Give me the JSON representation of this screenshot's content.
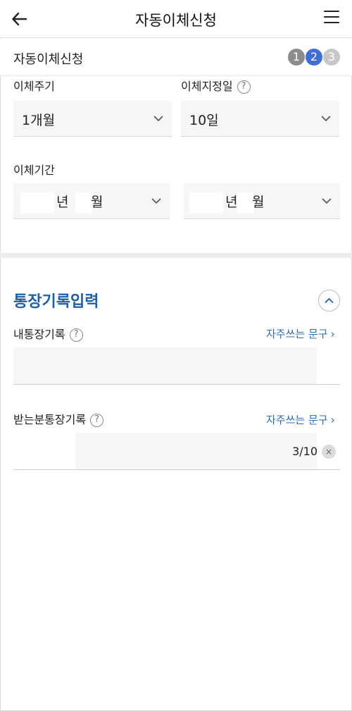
{
  "header": {
    "title": "자동이체신청",
    "back_icon": "back-arrow-icon",
    "menu_icon": "hamburger-menu-icon"
  },
  "stepbar": {
    "title": "자동이체신청",
    "steps": [
      {
        "label": "1",
        "state": "done",
        "color": "#8c8c8c"
      },
      {
        "label": "2",
        "state": "active",
        "color": "#3e6ed8"
      },
      {
        "label": "3",
        "state": "todo",
        "color": "#c8c8c8"
      }
    ]
  },
  "form": {
    "cycle_label": "이체주기",
    "cycle_value": "1개월",
    "day_label": "이체지정일",
    "day_value": "10일",
    "help_glyph": "?",
    "period_label": "이체기간",
    "period_start": {
      "year_unit": "년",
      "month_unit": "월"
    },
    "period_end": {
      "year_unit": "년",
      "month_unit": "월"
    }
  },
  "memo_section": {
    "title": "통장기록입력",
    "my_memo_label": "내통장기록",
    "my_memo_link": "자주쓰는 문구",
    "my_memo_value": "",
    "recipient_memo_label": "받는분통장기록",
    "recipient_memo_link": "자주쓰는 문구",
    "recipient_memo_counter": "3/10",
    "clear_glyph": "×",
    "link_arrow": "›"
  },
  "colors": {
    "accent_title": "#1f5fa3",
    "link": "#2f6db5",
    "field_bg": "#f5f6f8"
  }
}
